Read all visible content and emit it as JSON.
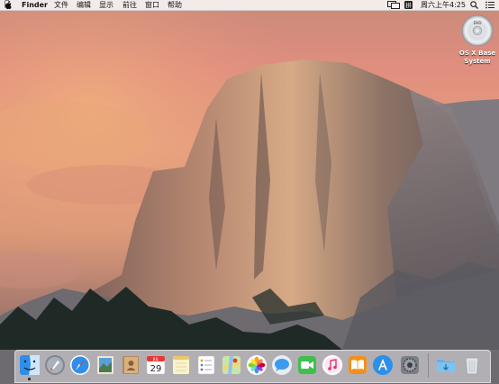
{
  "menubar": {
    "apple": "",
    "app_name": "Finder",
    "menus": [
      "文件",
      "编辑",
      "显示",
      "前往",
      "窗口",
      "帮助"
    ],
    "clock": "周六上午4:25",
    "status_icons": [
      "display-mirror-icon",
      "input-method-icon",
      "spotlight-icon",
      "notification-center-icon"
    ]
  },
  "desktop": {
    "disk_label_line1": "OS X Base",
    "disk_label_line2": "System",
    "disk_icon": "dvd-disc-icon"
  },
  "dock": {
    "items": [
      {
        "id": "finder",
        "icon": "finder-icon",
        "running": true
      },
      {
        "id": "launchpad",
        "icon": "launchpad-rocket-icon",
        "running": false
      },
      {
        "id": "safari",
        "icon": "safari-compass-icon",
        "running": false
      },
      {
        "id": "mail",
        "icon": "mail-stamp-icon",
        "running": false
      },
      {
        "id": "contacts",
        "icon": "contacts-book-icon",
        "running": false
      },
      {
        "id": "calendar",
        "icon": "calendar-icon",
        "running": false
      },
      {
        "id": "notes",
        "icon": "notes-icon",
        "running": false
      },
      {
        "id": "reminders",
        "icon": "reminders-icon",
        "running": false
      },
      {
        "id": "maps",
        "icon": "maps-icon",
        "running": false
      },
      {
        "id": "photos",
        "icon": "photos-icon",
        "running": false
      },
      {
        "id": "messages",
        "icon": "messages-icon",
        "running": false
      },
      {
        "id": "facetime",
        "icon": "facetime-icon",
        "running": false
      },
      {
        "id": "itunes",
        "icon": "itunes-icon",
        "running": false
      },
      {
        "id": "ibooks",
        "icon": "ibooks-icon",
        "running": false
      },
      {
        "id": "appstore",
        "icon": "app-store-icon",
        "running": false
      },
      {
        "id": "preferences",
        "icon": "system-preferences-icon",
        "running": false
      },
      {
        "id": "downloads",
        "icon": "downloads-folder-icon",
        "running": false
      },
      {
        "id": "trash",
        "icon": "trash-icon",
        "running": false
      }
    ],
    "calendar_month": "JUL",
    "calendar_day": "29"
  },
  "colors": {
    "menubar_bg": "#f5f3f2",
    "sky_top": "#c98a78",
    "sky_glow": "#e6a07c",
    "rock_light": "#c79c80",
    "rock_shadow": "#4e4a4e",
    "trees": "#1f2a27"
  }
}
